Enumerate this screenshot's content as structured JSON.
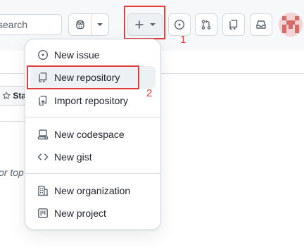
{
  "header": {
    "search_placeholder": "search",
    "copilot_icon": "copilot-icon",
    "create_icon": "plus-icon",
    "issues_icon": "issue-opened-icon",
    "pulls_icon": "git-pull-request-icon",
    "repo_icon": "repo-icon",
    "inbox_icon": "inbox-icon"
  },
  "annotations": {
    "step1": "1",
    "step2": "2",
    "color": "#e23c3c"
  },
  "background": {
    "star_label": "Sta",
    "italic_text": "or top"
  },
  "menu": {
    "items": [
      {
        "label": "New issue",
        "icon": "issue-opened-icon"
      },
      {
        "label": "New repository",
        "icon": "repo-icon"
      },
      {
        "label": "Import repository",
        "icon": "repo-push-icon"
      },
      {
        "label": "New codespace",
        "icon": "codespaces-icon"
      },
      {
        "label": "New gist",
        "icon": "code-icon"
      },
      {
        "label": "New organization",
        "icon": "organization-icon"
      },
      {
        "label": "New project",
        "icon": "project-icon"
      }
    ]
  }
}
